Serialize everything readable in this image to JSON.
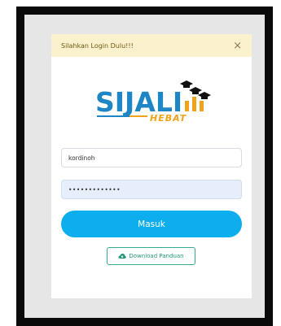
{
  "alert": {
    "message": "Silahkan Login Dulu!!!",
    "close_glyph": "×"
  },
  "logo": {
    "main_text": "SIJALI",
    "sub_text": "HEBAT",
    "icon": "graduation-cap-bar-chart-icon",
    "colors": {
      "primary": "#1f86c6",
      "accent": "#f0a21a",
      "cap": "#111111"
    }
  },
  "form": {
    "username_value": "kordinoh",
    "password_value": "•••••••••••••",
    "login_label": "Masuk",
    "download_label": "Download Panduan",
    "download_icon": "cloud-download-icon"
  },
  "colors": {
    "login_button": "#0daeee",
    "download_border": "#34ad93",
    "alert_background": "#fbf1cc"
  }
}
